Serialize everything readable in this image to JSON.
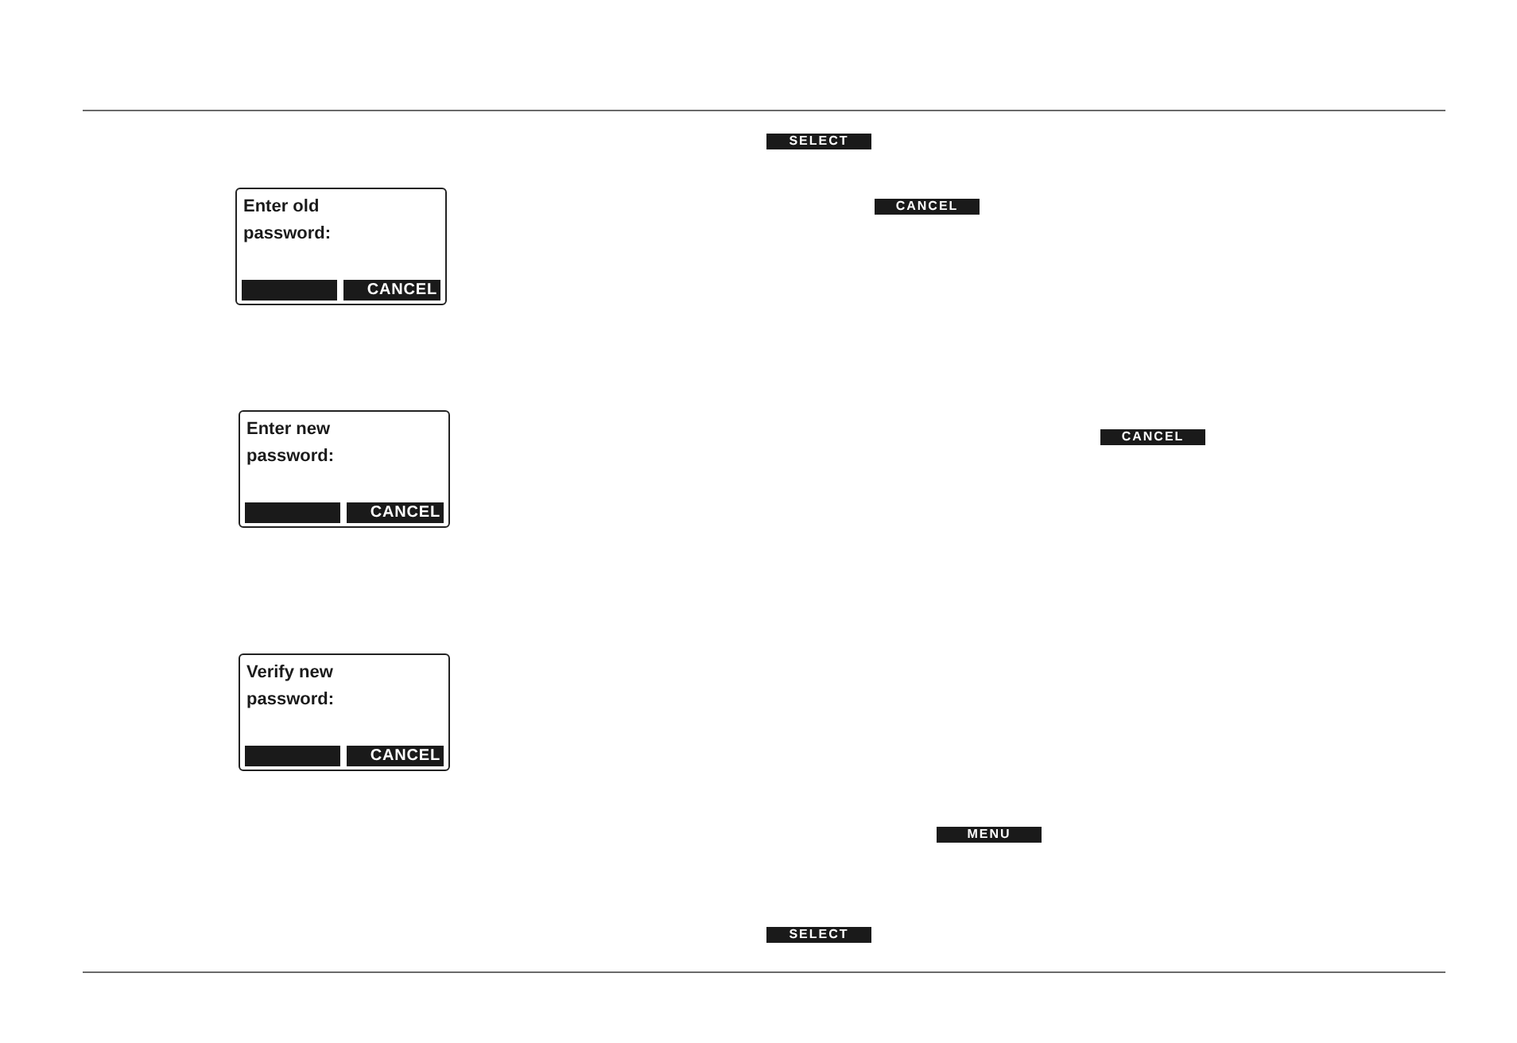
{
  "screens": [
    {
      "lines": [
        "Enter old",
        "password:"
      ],
      "right_softkey": "CANCEL"
    },
    {
      "lines": [
        "Enter new",
        "password:"
      ],
      "right_softkey": "CANCEL"
    },
    {
      "lines": [
        "Verify new",
        "password:"
      ],
      "right_softkey": "CANCEL"
    }
  ],
  "inline_softkeys": [
    "SELECT",
    "CANCEL",
    "CANCEL",
    "MENU",
    "SELECT"
  ]
}
